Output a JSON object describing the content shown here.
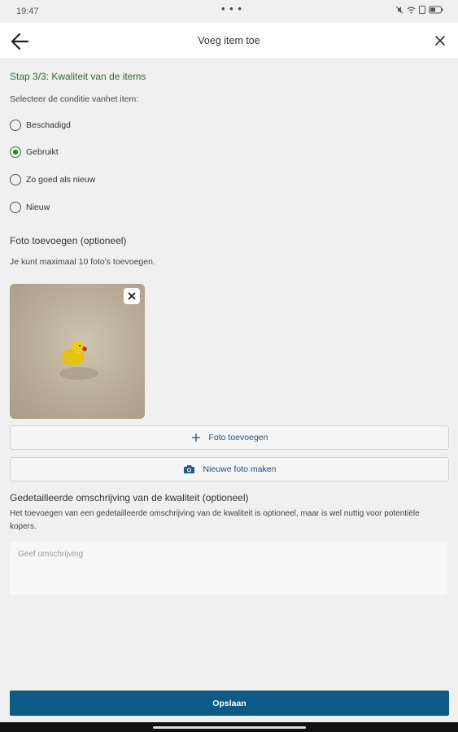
{
  "status": {
    "time": "19:47",
    "dots": "• • •"
  },
  "app_bar": {
    "title": "Voeg item toe"
  },
  "step_title": "Stap 3/3: Kwaliteit van de items",
  "condition": {
    "label": "Selecteer de conditie vanhet item:",
    "options": [
      {
        "label": "Beschadigd",
        "checked": false
      },
      {
        "label": "Gebruikt",
        "checked": true
      },
      {
        "label": "Zo goed als nieuw",
        "checked": false
      },
      {
        "label": "Nieuw",
        "checked": false
      }
    ]
  },
  "photos": {
    "title": "Foto toevoegen (optioneel)",
    "hint": "Je kunt maximaal 10 foto's toevoegen.",
    "add_label": "Foto toevoegen",
    "camera_label": "Nieuwe foto maken"
  },
  "description": {
    "title": "Gedetailleerde omschrijving van de kwaliteit (optioneel)",
    "text": "Het toevoegen van een gedetailleerde omschrijving van de kwaliteit is optioneel, maar is wel nuttig voor potentiële kopers.",
    "placeholder": "Geef omschrijving"
  },
  "save_label": "Opslaan",
  "colors": {
    "accent": "#0e5a86",
    "step_green": "#2e6b3a",
    "radio_green": "#2e7d32"
  },
  "icons": [
    "back-arrow-icon",
    "close-icon",
    "plus-icon",
    "camera-icon",
    "duck-photo"
  ]
}
